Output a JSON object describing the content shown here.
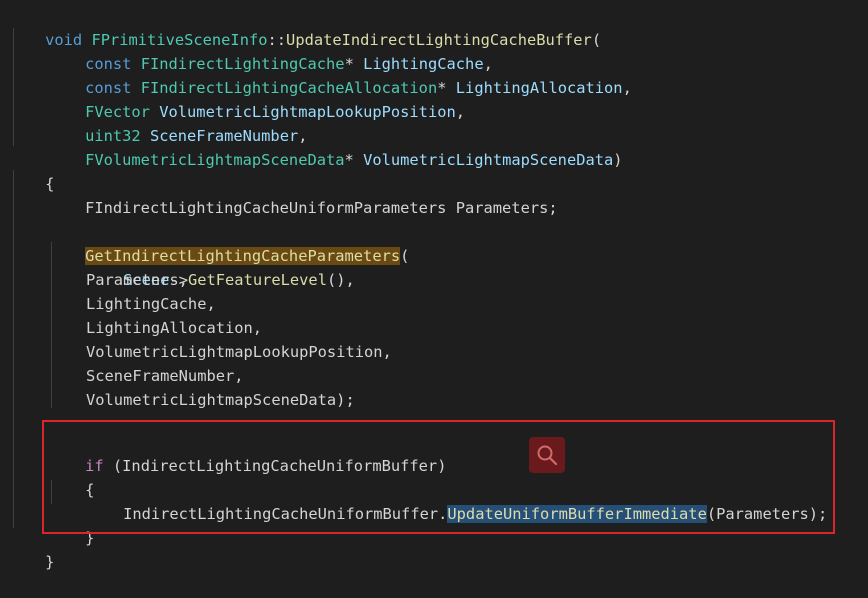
{
  "code": {
    "l1": {
      "a": "void",
      "b": "FPrimitiveSceneInfo",
      "c": "::",
      "d": "UpdateIndirectLightingCacheBuffer",
      "e": "("
    },
    "l2": {
      "a": "const",
      "b": "FIndirectLightingCache",
      "c": "*",
      "d": "LightingCache",
      "e": ","
    },
    "l3": {
      "a": "const",
      "b": "FIndirectLightingCacheAllocation",
      "c": "*",
      "d": "LightingAllocation",
      "e": ","
    },
    "l4": {
      "a": "FVector",
      "b": "VolumetricLightmapLookupPosition",
      "c": ","
    },
    "l5": {
      "a": "uint32",
      "b": "SceneFrameNumber",
      "c": ","
    },
    "l6": {
      "a": "FVolumetricLightmapSceneData",
      "b": "*",
      "c": "VolumetricLightmapSceneData",
      "d": ")"
    },
    "l7": {
      "a": "{"
    },
    "l8": {
      "a": "FIndirectLightingCacheUniformParameters Parameters;"
    },
    "l10": {
      "a": "GetIndirectLightingCacheParameters",
      "b": "("
    },
    "l11": {
      "a": "Scene",
      "b": "->",
      "c": "GetFeatureLevel",
      "d": "(),"
    },
    "l12": {
      "a": "Parameters,"
    },
    "l13": {
      "a": "LightingCache,"
    },
    "l14": {
      "a": "LightingAllocation,"
    },
    "l15": {
      "a": "VolumetricLightmapLookupPosition,"
    },
    "l16": {
      "a": "SceneFrameNumber,"
    },
    "l17": {
      "a": "VolumetricLightmapSceneData);"
    },
    "l19": {
      "a": "if",
      "b": " (IndirectLightingCacheUniformBuffer)"
    },
    "l20": {
      "a": "{"
    },
    "l21": {
      "a": "IndirectLightingCacheUniformBuffer.",
      "b": "UpdateUniformBufferImmediate",
      "c": "(Parameters);"
    },
    "l22": {
      "a": "}"
    },
    "l23": {
      "a": "}"
    }
  },
  "overlay": {
    "icon": "search-icon",
    "box_color": "#d9252b"
  }
}
